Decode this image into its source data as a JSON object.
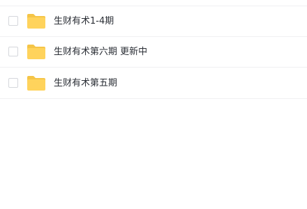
{
  "file_list": {
    "items": [
      {
        "name": "生财有术1-4期",
        "type_icon": "folder-icon"
      },
      {
        "name": "生财有术第六期 更新中",
        "type_icon": "folder-icon"
      },
      {
        "name": "生财有术第五期",
        "type_icon": "folder-icon"
      }
    ]
  },
  "colors": {
    "folder_body": "#FFD35C",
    "folder_tab": "#F5C547",
    "divider": "#F0F0F2",
    "text": "#2B2F36",
    "checkbox_border": "#D5D7DC"
  }
}
